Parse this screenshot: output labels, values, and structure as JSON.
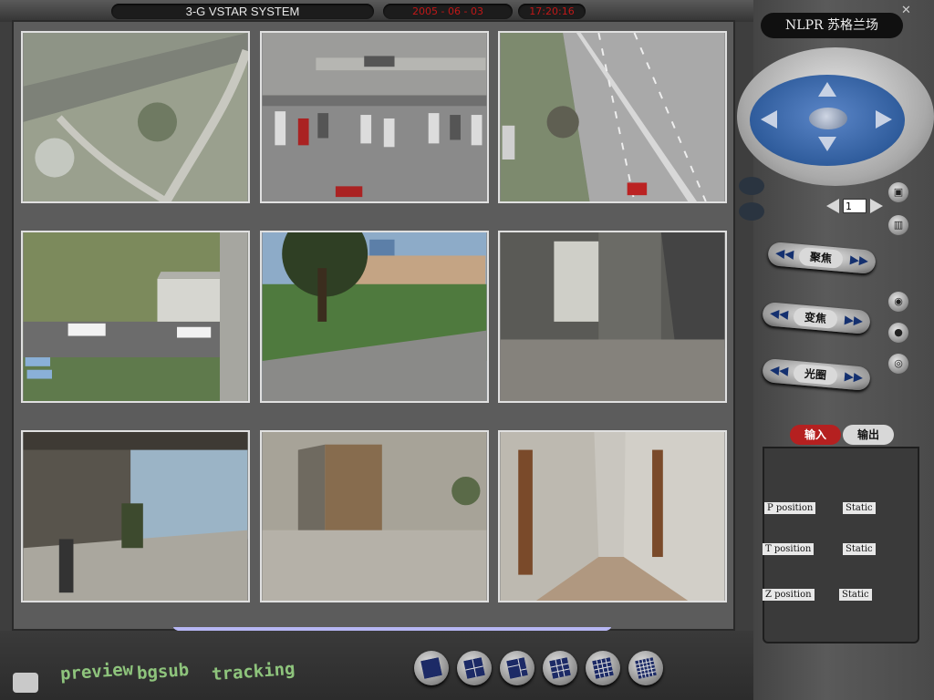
{
  "header": {
    "title": "3-G VSTAR SYSTEM",
    "date": "2005 - 06 - 03",
    "time": "17:20:16"
  },
  "brand": {
    "name": "NLPR 苏格兰场"
  },
  "cameras": [
    {
      "scene": "aerial-park"
    },
    {
      "scene": "parking-lot"
    },
    {
      "scene": "road"
    },
    {
      "scene": "building-lawn"
    },
    {
      "scene": "green-field"
    },
    {
      "scene": "corridor-door"
    },
    {
      "scene": "lobby"
    },
    {
      "scene": "wooden-door"
    },
    {
      "scene": "hallway"
    }
  ],
  "ptz": {
    "page_value": "1",
    "buttons": {
      "focus": "聚焦",
      "zoom": "变焦",
      "iris": "光圈"
    }
  },
  "io": {
    "tab_input": "输入",
    "tab_output": "输出",
    "rows": [
      {
        "label": "P position",
        "value": "Static"
      },
      {
        "label": "T position",
        "value": "Static"
      },
      {
        "label": "Z position",
        "value": "Static"
      }
    ]
  },
  "modes": [
    "preview",
    "bgsub",
    "tracking"
  ],
  "layouts": [
    "1x1",
    "2x2",
    "3-split",
    "3x3",
    "4x4",
    "5x5"
  ],
  "colors": {
    "status_red": "#c01818",
    "mode_green": "#8ec47c",
    "joystick_blue": "#2f5c9c"
  }
}
